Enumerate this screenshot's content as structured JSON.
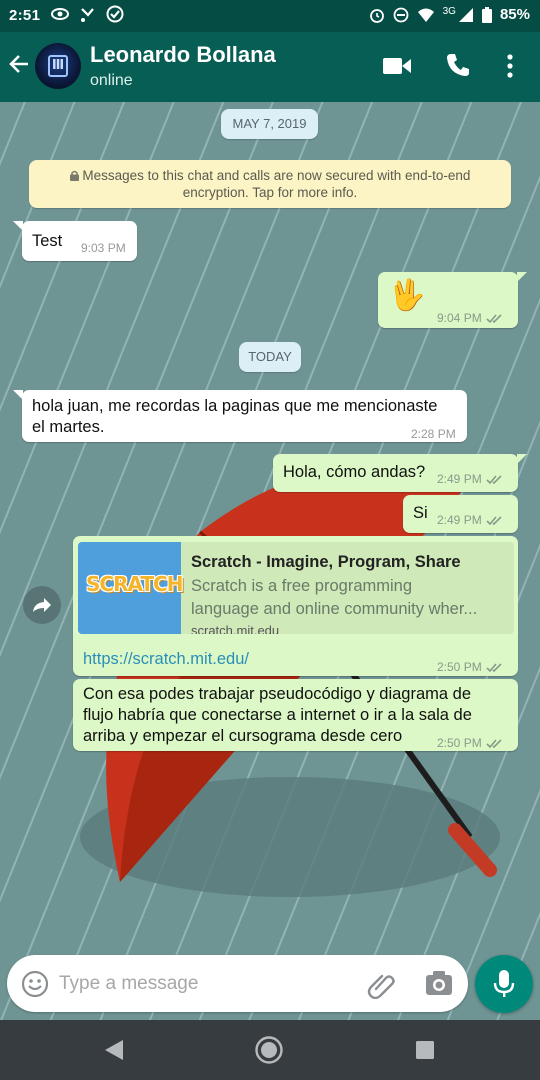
{
  "status_bar": {
    "time": "2:51",
    "network": "3G",
    "battery": "85%"
  },
  "header": {
    "contact_name": "Leonardo Bollana",
    "status": "online",
    "icons": [
      "back-arrow-icon",
      "video-call-icon",
      "phone-icon",
      "more-options-icon"
    ]
  },
  "chat": {
    "date_1": "MAY 7, 2019",
    "encryption_notice": {
      "line1": "Messages to this chat and calls are now secured with end-to-end",
      "line2": "encryption. Tap for more info."
    },
    "date_2": "TODAY",
    "messages": [
      {
        "direction": "in",
        "text": "Test",
        "time": "9:03 PM"
      },
      {
        "direction": "out",
        "text": "🖖",
        "time": "9:04 PM",
        "read": true
      },
      {
        "direction": "in",
        "line1": "hola juan, me recordas la paginas que me mencionaste",
        "line2": "el martes.",
        "time": "2:28 PM"
      },
      {
        "direction": "out",
        "text": "Hola, cómo andas?",
        "time": "2:49 PM",
        "read": true
      },
      {
        "direction": "out",
        "text": "Si",
        "time": "2:49 PM",
        "read": true
      },
      {
        "direction": "out",
        "type": "link",
        "preview_title": "Scratch - Imagine, Program, Share",
        "preview_desc_1": "Scratch is a free programming",
        "preview_desc_2": "language and online community wher...",
        "preview_domain": "scratch.mit.edu",
        "thumb_logo": "SCRATCH",
        "url": "https://scratch.mit.edu/",
        "time": "2:50 PM",
        "read": true
      },
      {
        "direction": "out",
        "line1": "Con esa podes trabajar pseudocódigo y diagrama de",
        "line2": "flujo habría que conectarse a internet o ir a la sala de",
        "line3": "arriba y empezar el cursograma desde cero",
        "time": "2:50 PM",
        "read": true
      }
    ]
  },
  "composer": {
    "placeholder": "Type a message",
    "icons": [
      "emoji-icon",
      "attach-icon",
      "camera-icon",
      "mic-icon"
    ]
  },
  "colors": {
    "header": "#075e54",
    "statusbar": "#054d44",
    "outgoing_bubble": "#dcf8c6",
    "incoming_bubble": "#ffffff",
    "accent": "#00897b",
    "read_ticks": "#8a9a8a"
  }
}
